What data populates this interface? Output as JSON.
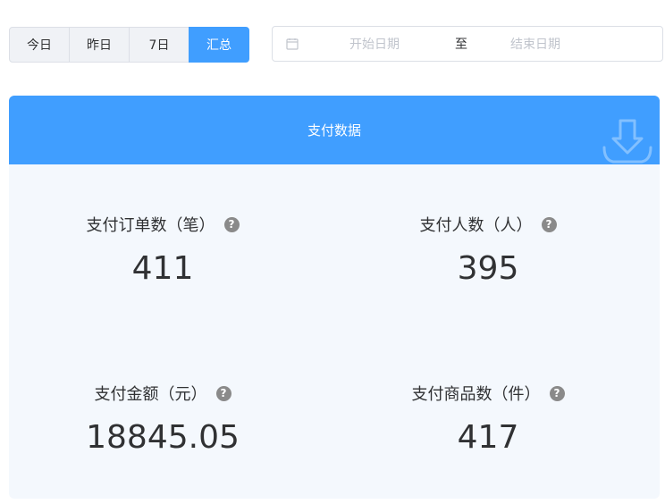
{
  "range_tabs": [
    {
      "label": "今日",
      "active": false
    },
    {
      "label": "昨日",
      "active": false
    },
    {
      "label": "7日",
      "active": false
    },
    {
      "label": "汇总",
      "active": true
    }
  ],
  "date_picker": {
    "icon": "calendar-icon",
    "start_placeholder": "开始日期",
    "separator": "至",
    "end_placeholder": "结束日期"
  },
  "card": {
    "title": "支付数据",
    "header_icon": "download-icon",
    "header_color": "#409eff"
  },
  "stats": [
    {
      "label": "支付订单数（笔）",
      "value": "411"
    },
    {
      "label": "支付人数（人）",
      "value": "395"
    },
    {
      "label": "支付金额（元）",
      "value": "18845.05"
    },
    {
      "label": "支付商品数（件）",
      "value": "417"
    }
  ],
  "help_icon_glyph": "?"
}
